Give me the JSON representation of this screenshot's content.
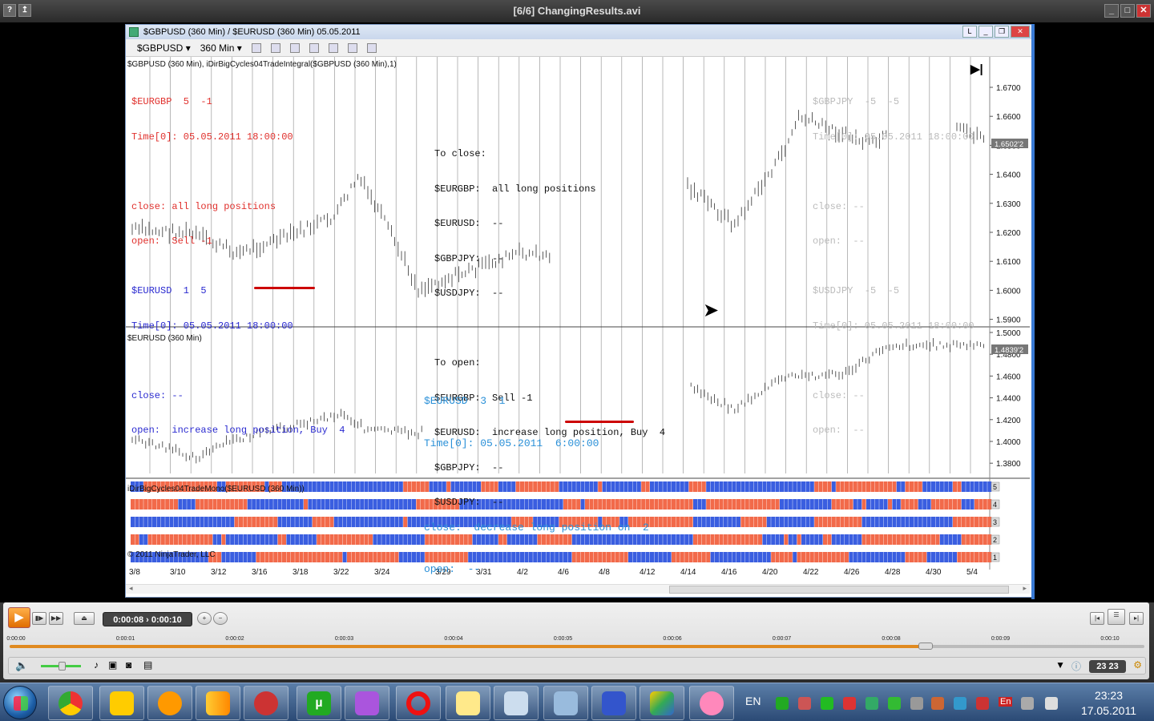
{
  "player": {
    "title": "[6/6] ChangingResults.avi",
    "left_buttons": [
      "?",
      "↥"
    ],
    "time_display": "0:00:08 › 0:00:10",
    "timeline_labels": [
      "0:00:00",
      "0:00:01",
      "0:00:02",
      "0:00:03",
      "0:00:04",
      "0:00:05",
      "0:00:06",
      "0:00:07",
      "0:00:08",
      "0:00:09",
      "0:00:10"
    ],
    "progress_fraction": 0.803,
    "counter_badge": "23 23"
  },
  "ninja": {
    "window_title": "$GBPUSD (360 Min) / $EURUSD (360 Min)  05.05.2011",
    "toolbar": {
      "instrument": "$GBPUSD",
      "interval": "360 Min"
    },
    "panel1_label": "$GBPUSD (360 Min), iDirBigCycles04TradeIntegral($GBPUSD (360 Min),1)",
    "panel2_label": "$EURUSD (360 Min)",
    "panel3_label": "iDirBigCycles04TradeMono($EURUSD (360 Min))",
    "copyright": "© 2011 NinjaTrader, LLC",
    "price_axis_1": [
      "1.6700",
      "1.6600",
      "1.6500",
      "1.6400",
      "1.6300",
      "1.6200",
      "1.6100",
      "1.6000",
      "1.5900"
    ],
    "current_price_1": "1.6502'2",
    "price_axis_2": [
      "1.5000",
      "1.4800",
      "1.4600",
      "1.4400",
      "1.4200",
      "1.4000",
      "1.3800"
    ],
    "current_price_2": "1.4839'2",
    "date_axis": [
      "3/8",
      "3/10",
      "3/12",
      "3/16",
      "3/18",
      "3/22",
      "3/24",
      "3/29",
      "3/31",
      "4/2",
      "4/6",
      "4/8",
      "4/12",
      "4/14",
      "4/16",
      "4/20",
      "4/22",
      "4/26",
      "4/28",
      "4/30",
      "5/4"
    ],
    "row_labels": [
      "5",
      "4",
      "3",
      "2",
      "1"
    ]
  },
  "annotations": {
    "eurgbp": [
      "$EURGBP  5  -1",
      "Time[0]: 05.05.2011 18:00:00",
      "",
      "close: all long positions",
      "open:  Sell -1"
    ],
    "eurusd": [
      "$EURUSD  1  5",
      "Time[0]: 05.05.2011 18:00:00",
      "",
      "close: --",
      "open:  increase long position, Buy  4"
    ],
    "summary": [
      "To close:",
      "$EURGBP:  all long positions",
      "$EURUSD:  --",
      "$GBPJPY:  --",
      "$USDJPY:  --",
      "",
      "To open:",
      "$EURGBP:  Sell -1",
      "$EURUSD:  increase long position, Buy  4",
      "$GBPJPY:  --",
      "$USDJPY:  --"
    ],
    "gbpjpy": [
      "$GBPJPY  -5  -5",
      "Time[0]: 05.05.2011 18:00:00",
      "",
      "close: --",
      "open:  --"
    ],
    "usdjpy": [
      "$USDJPY  -5  -5",
      "Time[0]: 05.05.2011 18:00:00",
      "",
      "close: --",
      "open:  --"
    ],
    "eurusd_mono": [
      "$EURUSD  3  1",
      "Time[0]: 05.05.2011  6:00:00",
      "",
      "close:  decrease long position on  2",
      "open:  --"
    ]
  },
  "taskbar": {
    "language": "EN",
    "tray_lang": "En",
    "time": "23:23",
    "date": "17.05.2011"
  },
  "colors": {
    "red_cell": "#f26a4a",
    "blue_cell": "#3a5ee0",
    "accent_orange": "#e08a20"
  }
}
